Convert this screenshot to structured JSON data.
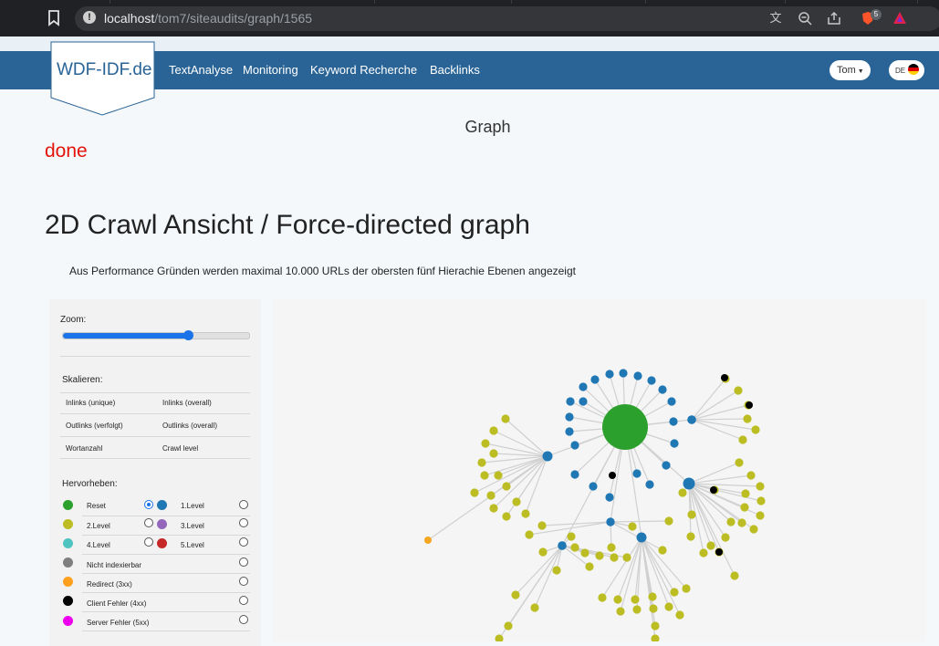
{
  "browser": {
    "url_host": "localhost",
    "url_path": "/tom7/siteaudits/graph/1565",
    "extension_badge": "5"
  },
  "header": {
    "logo": "WDF-IDF.de",
    "nav": [
      "TextAnalyse",
      "Monitoring",
      "Keyword Recherche",
      "Backlinks"
    ],
    "user": "Tom",
    "lang": "DE"
  },
  "page": {
    "subtitle": "Graph",
    "status": "done",
    "title": "2D Crawl Ansicht / Force-directed graph",
    "description": "Aus Performance Gründen werden maximal 10.000 URLs der obersten fünf Hierachie Ebenen angezeigt"
  },
  "panel": {
    "zoom_label": "Zoom:",
    "zoom_value": 0.67,
    "scale_label": "Skalieren:",
    "scale_options": [
      [
        "Inlinks (unique)",
        "Inlinks (overall)"
      ],
      [
        "Outlinks (verfolgt)",
        "Outlinks (overall)"
      ],
      [
        "Wortanzahl",
        "Crawl level"
      ]
    ],
    "highlight_label": "Hervorheben:",
    "highlight_rows": [
      {
        "left": {
          "label": "Reset",
          "color": "#2ca02c"
        },
        "right": {
          "label": "1.Level",
          "color": "#1f77b4"
        },
        "left_checked": true
      },
      {
        "left": {
          "label": "2.Level",
          "color": "#bcbd22"
        },
        "right": {
          "label": "3.Level",
          "color": "#9467bd"
        }
      },
      {
        "left": {
          "label": "4.Level",
          "color": "#4fc3c0"
        },
        "right": {
          "label": "5.Level",
          "color": "#c62828"
        }
      },
      {
        "left": {
          "label": "Nicht indexierbar",
          "color": "#7f7f7f"
        }
      },
      {
        "left": {
          "label": "Redirect (3xx)",
          "color": "#ff9f1c"
        }
      },
      {
        "left": {
          "label": "Client Fehler (4xx)",
          "color": "#000000"
        }
      },
      {
        "left": {
          "label": "Server Fehler (5xx)",
          "color": "#ee00ee"
        }
      }
    ]
  },
  "graph": {
    "colors": {
      "root": "#2ca02c",
      "level1": "#1f77b4",
      "level2": "#bcbd22",
      "error4xx": "#000000",
      "redirect": "#f5a623",
      "link": "#d0d0d0"
    }
  }
}
